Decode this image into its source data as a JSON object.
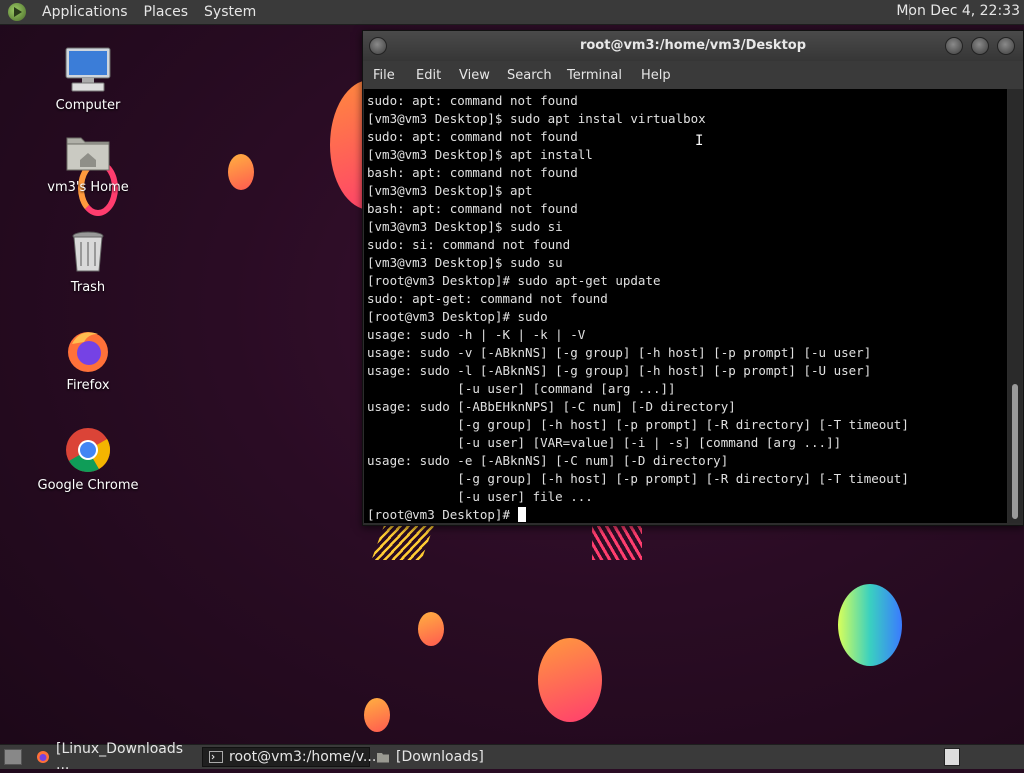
{
  "top_panel": {
    "menus": [
      "Applications",
      "Places",
      "System"
    ],
    "clock": "Mon Dec  4, 22:33"
  },
  "desktop_icons": [
    {
      "label": "Computer",
      "icon": "computer-icon"
    },
    {
      "label": "vm3's Home",
      "icon": "home-folder-icon"
    },
    {
      "label": "Trash",
      "icon": "trash-icon"
    },
    {
      "label": "Firefox",
      "icon": "firefox-icon"
    },
    {
      "label": "Google Chrome",
      "icon": "chrome-icon"
    }
  ],
  "terminal": {
    "title": "root@vm3:/home/vm3/Desktop",
    "menu": [
      "File",
      "Edit",
      "View",
      "Search",
      "Terminal",
      "Help"
    ],
    "lines": [
      "sudo: apt: command not found",
      "[vm3@vm3 Desktop]$ sudo apt instal virtualbox",
      "sudo: apt: command not found",
      "[vm3@vm3 Desktop]$ apt install",
      "bash: apt: command not found",
      "[vm3@vm3 Desktop]$ apt",
      "bash: apt: command not found",
      "[vm3@vm3 Desktop]$ sudo si",
      "sudo: si: command not found",
      "[vm3@vm3 Desktop]$ sudo su",
      "[root@vm3 Desktop]# sudo apt-get update",
      "sudo: apt-get: command not found",
      "[root@vm3 Desktop]# sudo",
      "usage: sudo -h | -K | -k | -V",
      "usage: sudo -v [-ABknNS] [-g group] [-h host] [-p prompt] [-u user]",
      "usage: sudo -l [-ABknNS] [-g group] [-h host] [-p prompt] [-U user]",
      "            [-u user] [command [arg ...]]",
      "usage: sudo [-ABbEHknNPS] [-C num] [-D directory]",
      "            [-g group] [-h host] [-p prompt] [-R directory] [-T timeout]",
      "            [-u user] [VAR=value] [-i | -s] [command [arg ...]]",
      "usage: sudo -e [-ABknNS] [-C num] [-D directory]",
      "            [-g group] [-h host] [-p prompt] [-R directory] [-T timeout]",
      "            [-u user] file ..."
    ],
    "prompt": "[root@vm3 Desktop]# "
  },
  "taskbar": {
    "items": [
      {
        "label": "[Linux_Downloads ...",
        "icon": "firefox-icon",
        "active": false
      },
      {
        "label": "root@vm3:/home/v...",
        "icon": "terminal-icon",
        "active": true
      },
      {
        "label": "[Downloads]",
        "icon": "folder-icon",
        "active": false
      }
    ]
  },
  "colors": {
    "wallpaper": "#2a0c24",
    "panel": "#3a3a3a",
    "terminal_bg": "#000000",
    "terminal_fg": "#e0e0e0"
  }
}
